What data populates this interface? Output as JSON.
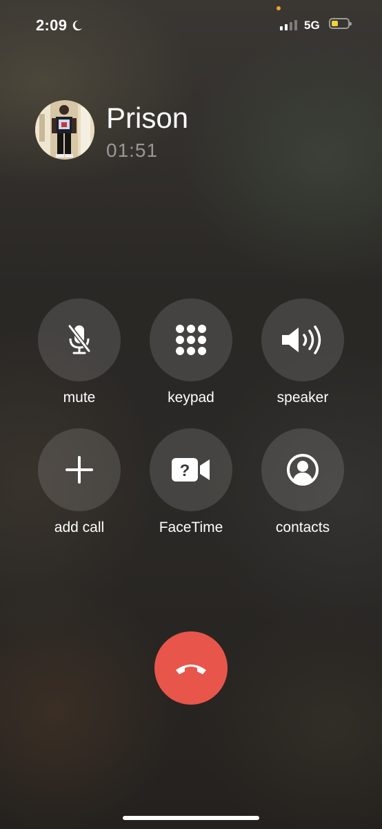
{
  "status_bar": {
    "time": "2:09",
    "network": "5G",
    "signal_bars": 2,
    "signal_bars_total": 4,
    "battery_level": 0.3,
    "battery_color": "#f2d03a"
  },
  "call": {
    "caller_name": "Prison",
    "duration": "01:51"
  },
  "controls": [
    {
      "label": "mute",
      "icon": "mic-slash-icon"
    },
    {
      "label": "keypad",
      "icon": "keypad-icon"
    },
    {
      "label": "speaker",
      "icon": "speaker-icon"
    },
    {
      "label": "add call",
      "icon": "plus-icon"
    },
    {
      "label": "FaceTime",
      "icon": "facetime-question-icon"
    },
    {
      "label": "contacts",
      "icon": "person-circle-icon"
    }
  ],
  "end_call": {
    "icon": "end-call-icon",
    "color": "#e8554b"
  },
  "avatar_icon": "caller-photo"
}
